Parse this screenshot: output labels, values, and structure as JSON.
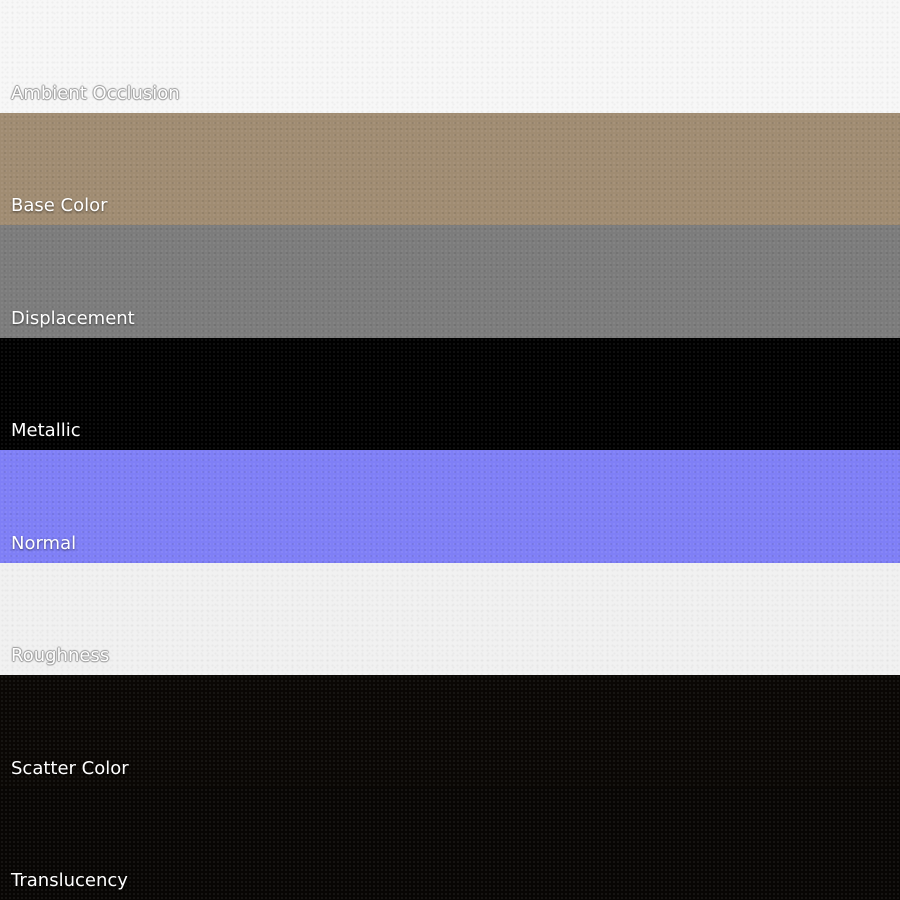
{
  "maps": [
    {
      "key": "ambient_occlusion",
      "label": "Ambient Occlusion",
      "color": "#f7f7f7",
      "tone": "light"
    },
    {
      "key": "base_color",
      "label": "Base Color",
      "color": "#a08c72",
      "tone": "dark"
    },
    {
      "key": "displacement",
      "label": "Displacement",
      "color": "#7c7c7c",
      "tone": "dark"
    },
    {
      "key": "metallic",
      "label": "Metallic",
      "color": "#000000",
      "tone": "dark"
    },
    {
      "key": "normal",
      "label": "Normal",
      "color": "#7f7ff6",
      "tone": "dark"
    },
    {
      "key": "roughness",
      "label": "Roughness",
      "color": "#f1f1f1",
      "tone": "light"
    },
    {
      "key": "scatter_color",
      "label": "Scatter Color",
      "color": "#0a0704",
      "tone": "dark"
    },
    {
      "key": "translucency",
      "label": "Translucency",
      "color": "#080604",
      "tone": "dark"
    }
  ]
}
